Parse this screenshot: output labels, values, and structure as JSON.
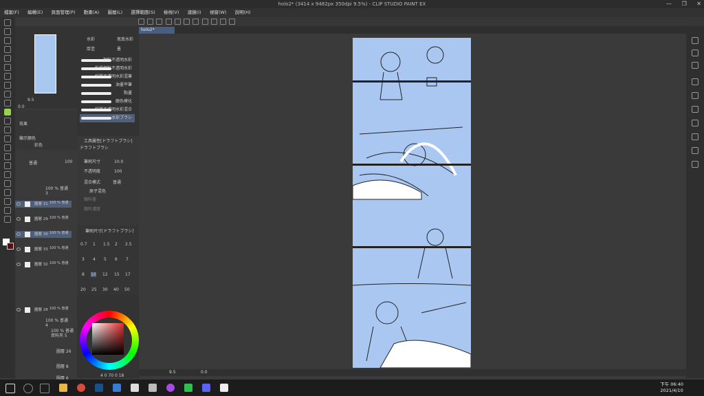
{
  "window": {
    "title": "holo2* (3414 x 9482px 350dpi 9.5%) - CLIP STUDIO PAINT EX",
    "controls": [
      "—",
      "❐",
      "✕"
    ]
  },
  "menu": [
    "檔案(F)",
    "編輯(E)",
    "頁面管理(P)",
    "動畫(A)",
    "圖層(L)",
    "選擇範圍(S)",
    "檢視(V)",
    "濾鏡(I)",
    "視窗(W)",
    "說明(H)"
  ],
  "document_tab": "holo2*",
  "subtool": {
    "groups": [
      "水彩",
      "厚塗",
      "寫真水彩",
      "墨"
    ],
    "brushes": [
      "顏料不透明水彩",
      "乾燥顏料不透明水彩",
      "紙質不透明水彩混筆",
      "油畫平筆",
      "點畫",
      "顏色模化",
      "紙質不透明水彩混合",
      "水彩ブラシ"
    ]
  },
  "tool_property": {
    "header": "工具屬性[ドラフトブラシ]",
    "brush_name": "ドラフトブラシ",
    "size_label": "筆刷尺寸",
    "size_value": "10.0",
    "opacity_label": "不透明度",
    "opacity_value": "100",
    "blend_label": "混合模式",
    "blend_value": "普通",
    "mix_label": "原子混色",
    "dim1": "顏料量",
    "dim2": "顏料濃度"
  },
  "brush_size": {
    "header": "筆刷尺寸[ドラフトブラシ]",
    "values": [
      "0.7",
      "1",
      "1.5",
      "2",
      "2.5",
      "3",
      "4",
      "5",
      "6",
      "7",
      "8",
      "10",
      "12",
      "15",
      "17",
      "20",
      "25",
      "30",
      "40",
      "50"
    ]
  },
  "layer_panel": {
    "effect_label": "效果",
    "display_color_label": "顯示顏色",
    "display_color_value": "彩色",
    "blend_mode": "普通",
    "opacity": "100",
    "folder_name": "100 % 普通\n3",
    "layers": [
      {
        "mode": "100 % 普通",
        "name": "圖層 31",
        "selected": true
      },
      {
        "mode": "100 % 普通",
        "name": "圖層 29",
        "selected": false
      },
      {
        "mode": "100 % 普通",
        "name": "圖層 30",
        "selected": true
      },
      {
        "mode": "100 % 普通",
        "name": "圖層 33",
        "selected": false
      },
      {
        "mode": "100 % 普通",
        "name": "圖層 32",
        "selected": false
      },
      {
        "mode": "100 % 普通",
        "name": "圖層 28",
        "selected": false
      }
    ],
    "folder2": "100 % 普通\n4",
    "folder3": "100 % 普通\n資料夾 5",
    "sub_layers": [
      "圖層 26",
      "圖層 8",
      "圖層 6"
    ]
  },
  "navigator": {
    "zoom": "9.5",
    "rotate": "0.0"
  },
  "color_panel": {
    "values": "4 0 70 0 18"
  },
  "status": {
    "zoom": "9.5",
    "rotate": "0.0"
  },
  "taskbar": {
    "time": "下午 06:40",
    "date": "2021/4/10"
  },
  "colors": {
    "accent": "#4f5f7a",
    "page": "#a9c7f1",
    "tool_selected": "#9ad34a"
  }
}
